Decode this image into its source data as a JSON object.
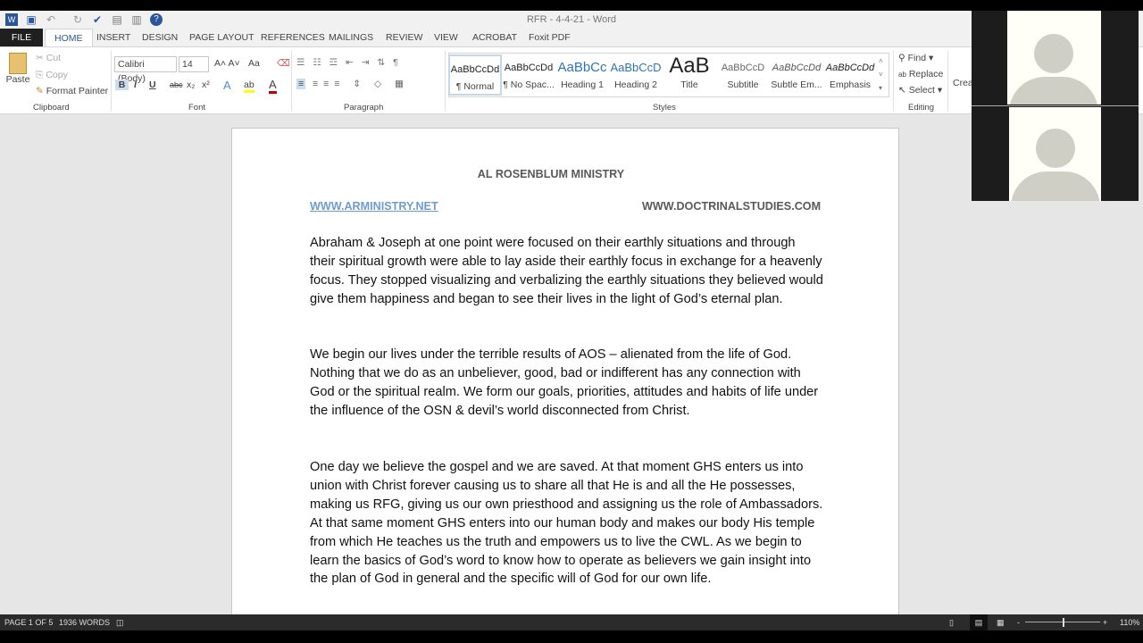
{
  "window": {
    "title": "RFR - 4-4-21 - Word"
  },
  "quick_access": [
    {
      "icon": "word-icon"
    },
    {
      "icon": "save-icon"
    },
    {
      "icon": "undo-icon"
    },
    {
      "icon": "redo-icon"
    },
    {
      "icon": "spelling-icon"
    },
    {
      "icon": "print-preview-icon"
    },
    {
      "icon": "clipboard-icon"
    },
    {
      "icon": "help-icon"
    }
  ],
  "tabs": [
    "FILE",
    "HOME",
    "INSERT",
    "DESIGN",
    "PAGE LAYOUT",
    "REFERENCES",
    "MAILINGS",
    "REVIEW",
    "VIEW",
    "ACROBAT",
    "Foxit PDF"
  ],
  "ribbon": {
    "clipboard": {
      "paste": "Paste",
      "cut": "Cut",
      "copy": "Copy",
      "format_painter": "Format Painter",
      "label": "Clipboard"
    },
    "font": {
      "name": "Calibri (Body)",
      "size": "14",
      "change_case": "Aa",
      "label": "Font",
      "font_color": "#c00000",
      "highlight": "#ffff00"
    },
    "paragraph": {
      "label": "Paragraph"
    },
    "styles": {
      "label": "Styles",
      "items": [
        {
          "preview": "AaBbCcDd",
          "name": "¶ Normal"
        },
        {
          "preview": "AaBbCcDd",
          "name": "¶ No Spac..."
        },
        {
          "preview": "AaBbCc",
          "name": "Heading 1"
        },
        {
          "preview": "AaBbCcD",
          "name": "Heading 2"
        },
        {
          "preview": "AaB",
          "name": "Title"
        },
        {
          "preview": "AaBbCcD",
          "name": "Subtitle"
        },
        {
          "preview": "AaBbCcDd",
          "name": "Subtle Em..."
        },
        {
          "preview": "AaBbCcDd",
          "name": "Emphasis"
        }
      ]
    },
    "editing": {
      "find": "Find",
      "replace": "Replace",
      "select": "Select",
      "label": "Editing",
      "create": "Crea"
    }
  },
  "document": {
    "heading": "AL ROSENBLUM MINISTRY",
    "link_left": "WWW.ARMINISTRY.NET",
    "link_right": "WWW.DOCTRINALSTUDIES.COM",
    "paragraphs": [
      "Abraham & Joseph at one point were focused on their earthly situations and through their spiritual growth were able to lay aside their earthly focus in exchange for a heavenly focus. They stopped visualizing and verbalizing the earthly situations they believed would give them happiness and began to see their lives in the light of God’s eternal plan.",
      "We begin our lives under the terrible results of AOS – alienated from the life of God. Nothing that we do as an unbeliever, good, bad or indifferent has any connection with God or the spiritual realm. We form our goals, priorities, attitudes and habits of life under the influence of the OSN & devil’s world disconnected from Christ.",
      "One day we believe the gospel and we are saved. At that moment GHS enters us into union with Christ forever causing us to share all that He is and all the He possesses, making us RFG, giving us our own priesthood and assigning us the role of Ambassadors. At that same moment GHS enters into our human body and makes our body His temple from which He teaches us the truth and empowers us to live the CWL. As we begin to learn the basics of God’s word to know how to operate as believers we gain insight into the plan of God in general and the specific will of God for our own life."
    ]
  },
  "status": {
    "page": "PAGE 1 OF 5",
    "words": "1936 WORDS",
    "zoom": "110%",
    "zoom_minus": "-",
    "zoom_plus": "+"
  }
}
